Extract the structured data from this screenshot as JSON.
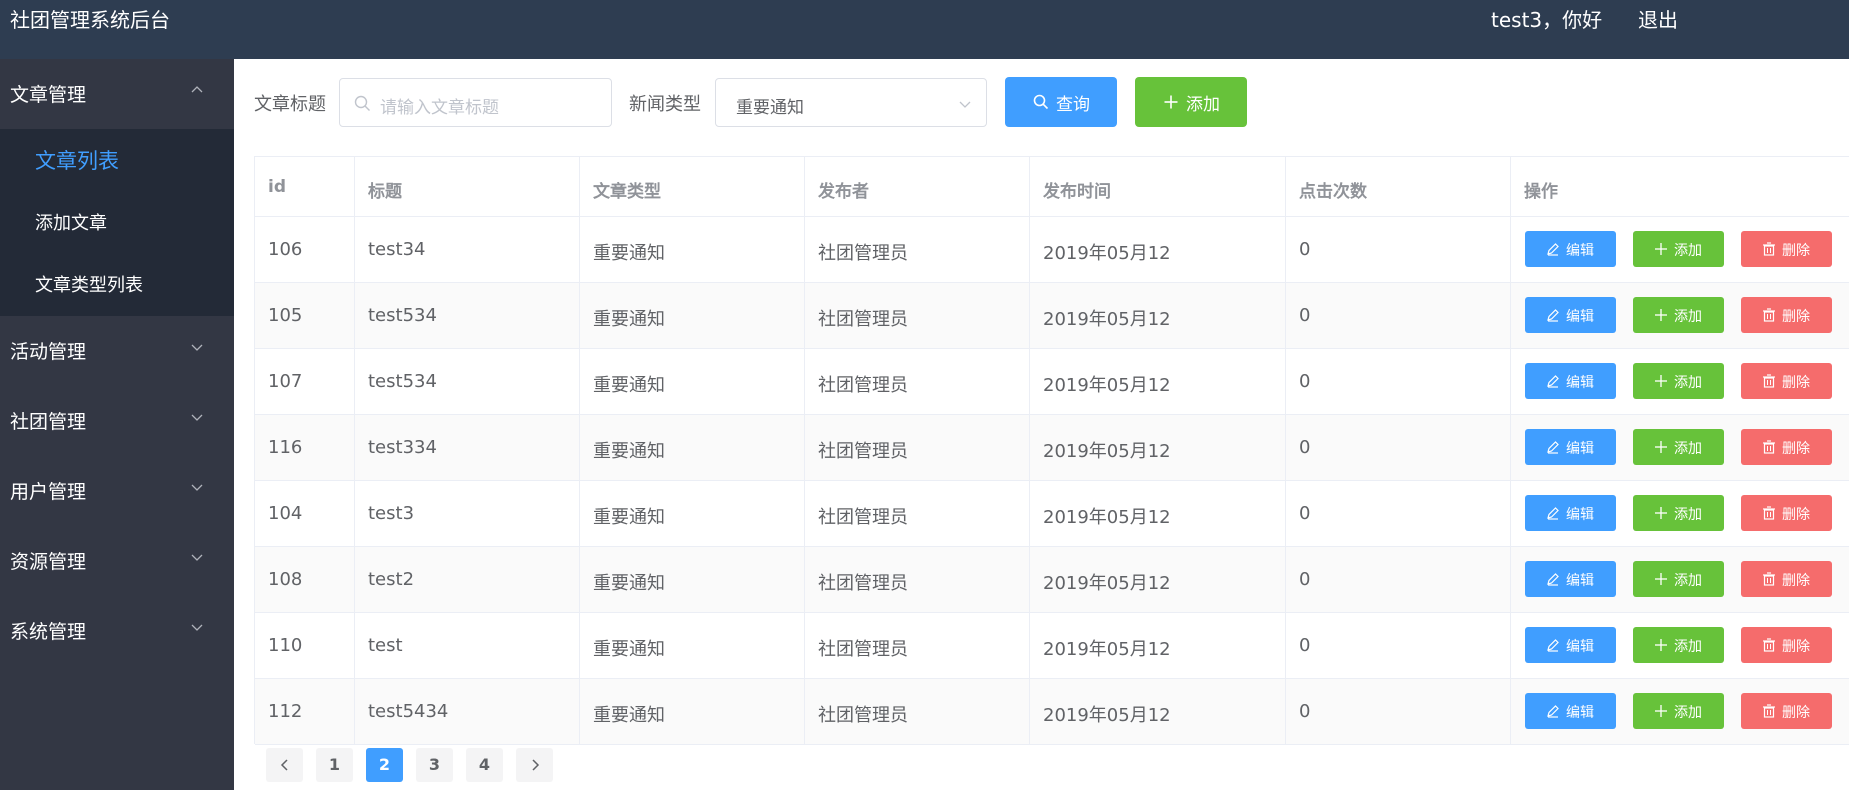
{
  "header": {
    "title": "社团管理系统后台",
    "greeting": "test3，你好",
    "logout": "退出"
  },
  "sidebar": {
    "groups": [
      {
        "label": "文章管理",
        "expanded": true
      },
      {
        "label": "活动管理"
      },
      {
        "label": "社团管理"
      },
      {
        "label": "用户管理"
      },
      {
        "label": "资源管理"
      },
      {
        "label": "系统管理"
      }
    ],
    "sub_items": [
      {
        "label": "文章列表",
        "active": true
      },
      {
        "label": "添加文章"
      },
      {
        "label": "文章类型列表"
      }
    ]
  },
  "toolbar": {
    "title_label": "文章标题",
    "title_placeholder": "请输入文章标题",
    "type_label": "新闻类型",
    "type_value": "重要通知",
    "query_label": "查询",
    "add_label": "添加"
  },
  "table": {
    "columns": [
      "id",
      "标题",
      "文章类型",
      "发布者",
      "发布时间",
      "点击次数",
      "操作"
    ],
    "actions": {
      "edit": "编辑",
      "add": "添加",
      "delete": "删除"
    },
    "rows": [
      [
        "106",
        "test34",
        "重要通知",
        "社团管理员",
        "2019年05月12",
        "0"
      ],
      [
        "105",
        "test534",
        "重要通知",
        "社团管理员",
        "2019年05月12",
        "0"
      ],
      [
        "107",
        "test534",
        "重要通知",
        "社团管理员",
        "2019年05月12",
        "0"
      ],
      [
        "116",
        "test334",
        "重要通知",
        "社团管理员",
        "2019年05月12",
        "0"
      ],
      [
        "104",
        "test3",
        "重要通知",
        "社团管理员",
        "2019年05月12",
        "0"
      ],
      [
        "108",
        "test2",
        "重要通知",
        "社团管理员",
        "2019年05月12",
        "0"
      ],
      [
        "110",
        "test",
        "重要通知",
        "社团管理员",
        "2019年05月12",
        "0"
      ],
      [
        "112",
        "test5434",
        "重要通知",
        "社团管理员",
        "2019年05月12",
        "0"
      ]
    ]
  },
  "pagination": {
    "pages": [
      "1",
      "2",
      "3",
      "4"
    ],
    "current": "2"
  },
  "colors": {
    "primary": "#409eff",
    "success": "#67c23a",
    "danger": "#f56c6c",
    "header_bg": "#2e3d51",
    "sidebar_bg": "#333744"
  }
}
